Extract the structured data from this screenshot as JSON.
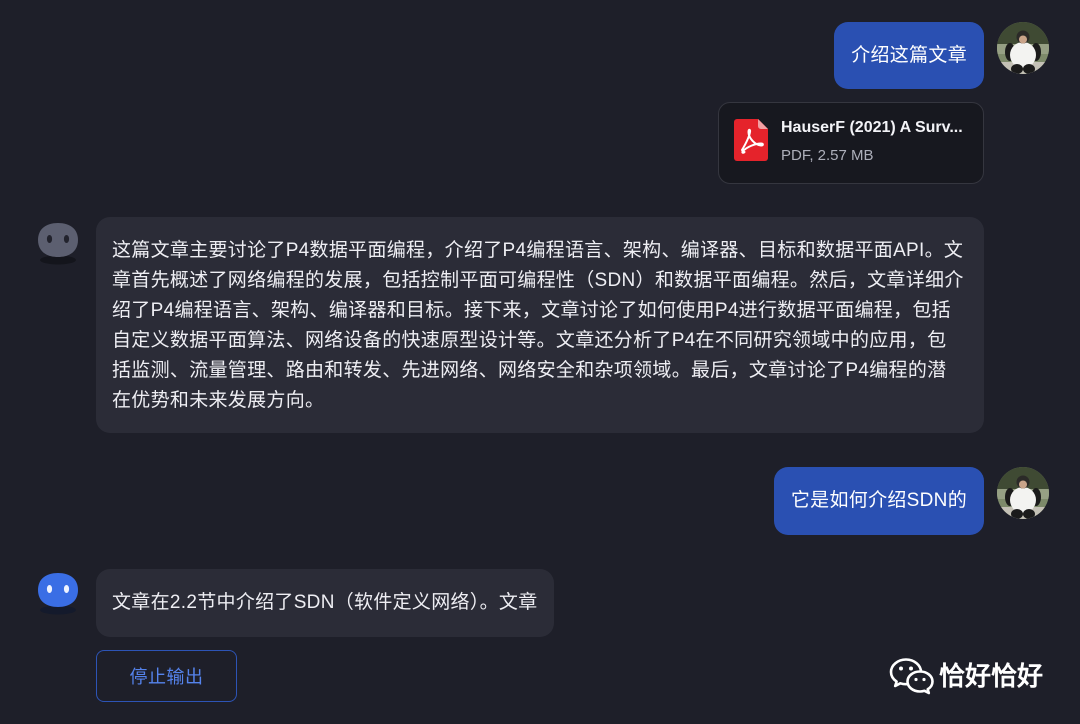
{
  "messages": {
    "user_1": {
      "avatar": "panda-avatar",
      "text": "介绍这篇文章"
    },
    "attachment": {
      "icon": "pdf-icon",
      "name": "HauserF (2021) A Surv...",
      "meta": "PDF, 2.57 MB"
    },
    "assistant_1": {
      "avatar": "bot-avatar-icon",
      "lines": [
        "这篇文章主要讨论了P4数据平面编程，介绍了P4编程语言、架构、编译器、目标和数据平面API。文",
        "章首先概述了网络编程的发展，包括控制平面可编程性（SDN）和数据平面编程。然后，文章详细介",
        "绍了P4编程语言、架构、编译器和目标。接下来，文章讨论了如何使用P4进行数据平面编程，包括",
        "自定义数据平面算法、网络设备的快速原型设计等。文章还分析了P4在不同研究领域中的应用，包",
        "括监测、流量管理、路由和转发、先进网络、网络安全和杂项领域。最后，文章讨论了P4编程的潜",
        "在优势和未来发展方向。"
      ]
    },
    "user_2": {
      "avatar": "panda-avatar",
      "text": "它是如何介绍SDN的"
    },
    "assistant_2": {
      "avatar": "bot-avatar-icon",
      "text": "文章在2.2节中介绍了SDN（软件定义网络）。文章"
    }
  },
  "stop_button": {
    "label": "停止输出"
  },
  "watermark": {
    "icon": "wechat-icon",
    "text": "恰好恰好"
  },
  "colors": {
    "background": "#1e1f29",
    "assistant_bubble": "#2b2c37",
    "user_bubble": "#2a50b2",
    "card_background": "#17181f",
    "card_border": "#35363f",
    "accent": "#5583ec",
    "accent_border": "#2d54b6",
    "pdf_red": "#e5232b",
    "assistant_avatar_idle": "#5c5f70",
    "assistant_avatar_active": "#3a6ee5"
  }
}
